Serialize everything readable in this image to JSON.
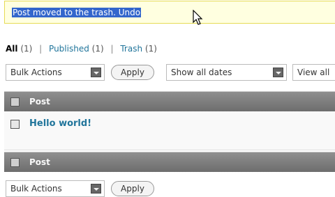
{
  "notice": {
    "message": "Post moved to the trash. Undo"
  },
  "filters": {
    "all": {
      "label": "All",
      "count": "(1)"
    },
    "published": {
      "label": "Published",
      "count": "(1)"
    },
    "trash": {
      "label": "Trash",
      "count": "(1)"
    }
  },
  "toolbar_top": {
    "bulk_actions": "Bulk Actions",
    "apply": "Apply",
    "dates": "Show all dates",
    "view_all": "View all"
  },
  "table": {
    "column_header": "Post",
    "rows": [
      {
        "title": "Hello world!"
      }
    ],
    "footer_header": "Post"
  },
  "toolbar_bottom": {
    "bulk_actions": "Bulk Actions",
    "apply": "Apply"
  },
  "colors": {
    "notice_bg": "#ffffe0",
    "selection": "#3366cc",
    "link": "#21759b",
    "header": "#7d7d7d"
  }
}
